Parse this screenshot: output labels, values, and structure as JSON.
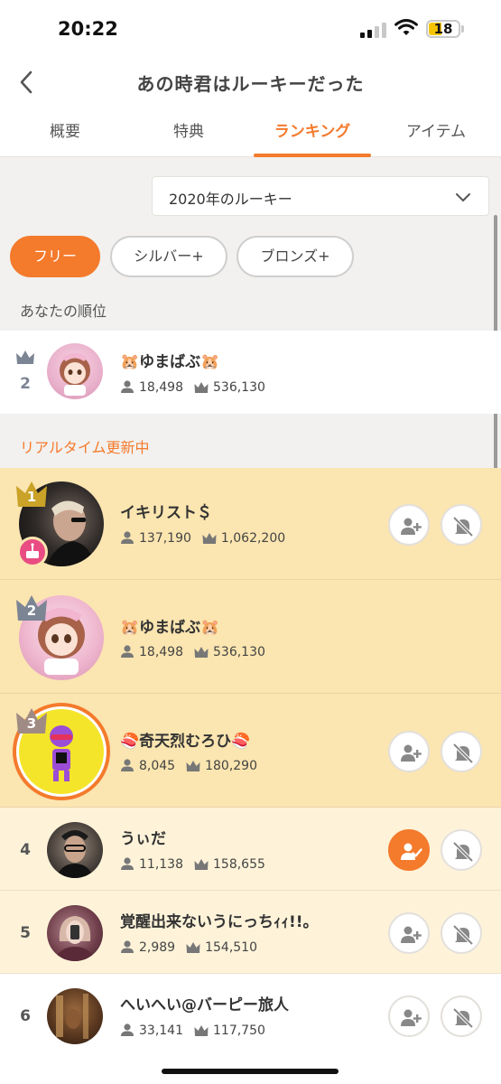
{
  "status_bar": {
    "time": "20:22",
    "battery": "18"
  },
  "nav": {
    "title": "あの時君はルーキーだった"
  },
  "tabs": [
    {
      "label": "概要",
      "active": false
    },
    {
      "label": "特典",
      "active": false
    },
    {
      "label": "ランキング",
      "active": true
    },
    {
      "label": "アイテム",
      "active": false
    }
  ],
  "year_select": {
    "value": "2020年のルーキー"
  },
  "filters": [
    {
      "label": "フリー",
      "selected": true
    },
    {
      "label": "シルバー+",
      "selected": false
    },
    {
      "label": "ブロンズ+",
      "selected": false
    }
  ],
  "your_rank": {
    "heading": "あなたの順位",
    "rank": "2",
    "name": "🐹ゆまばぶ🐹",
    "followers": "18,498",
    "points": "536,130"
  },
  "realtime_label": "リアルタイム更新中",
  "ranking": [
    {
      "rank": "1",
      "name": "イキリスト＄",
      "followers": "137,190",
      "points": "1,062,200",
      "followed": false
    },
    {
      "rank": "2",
      "name": "🐹ゆまばぶ🐹",
      "followers": "18,498",
      "points": "536,130",
      "followed": false
    },
    {
      "rank": "3",
      "name": "🍣奇天烈むろひ🍣",
      "followers": "8,045",
      "points": "180,290",
      "followed": false
    },
    {
      "rank": "4",
      "name": "うぃだ",
      "followers": "11,138",
      "points": "158,655",
      "followed": true
    },
    {
      "rank": "5",
      "name": "覚醒出来ないうにっちｨｨ!!。",
      "followers": "2,989",
      "points": "154,510",
      "followed": false
    },
    {
      "rank": "6",
      "name": "へいへい@バーピー旅人",
      "followers": "33,141",
      "points": "117,750",
      "followed": false
    }
  ],
  "icons": {
    "back": "chevron-left-icon",
    "dropdown": "chevron-down-icon",
    "follow": "person-add-icon",
    "followed": "person-check-icon",
    "mute": "bell-off-icon",
    "followers": "person-icon",
    "points": "crown-icon"
  },
  "colors": {
    "accent": "#f47a2c",
    "gold_row": "#fbe5b0",
    "cream_row": "#fef3d9",
    "rank1": "#c9a227",
    "rank2": "#7c8594",
    "rank3": "#a08b84"
  }
}
